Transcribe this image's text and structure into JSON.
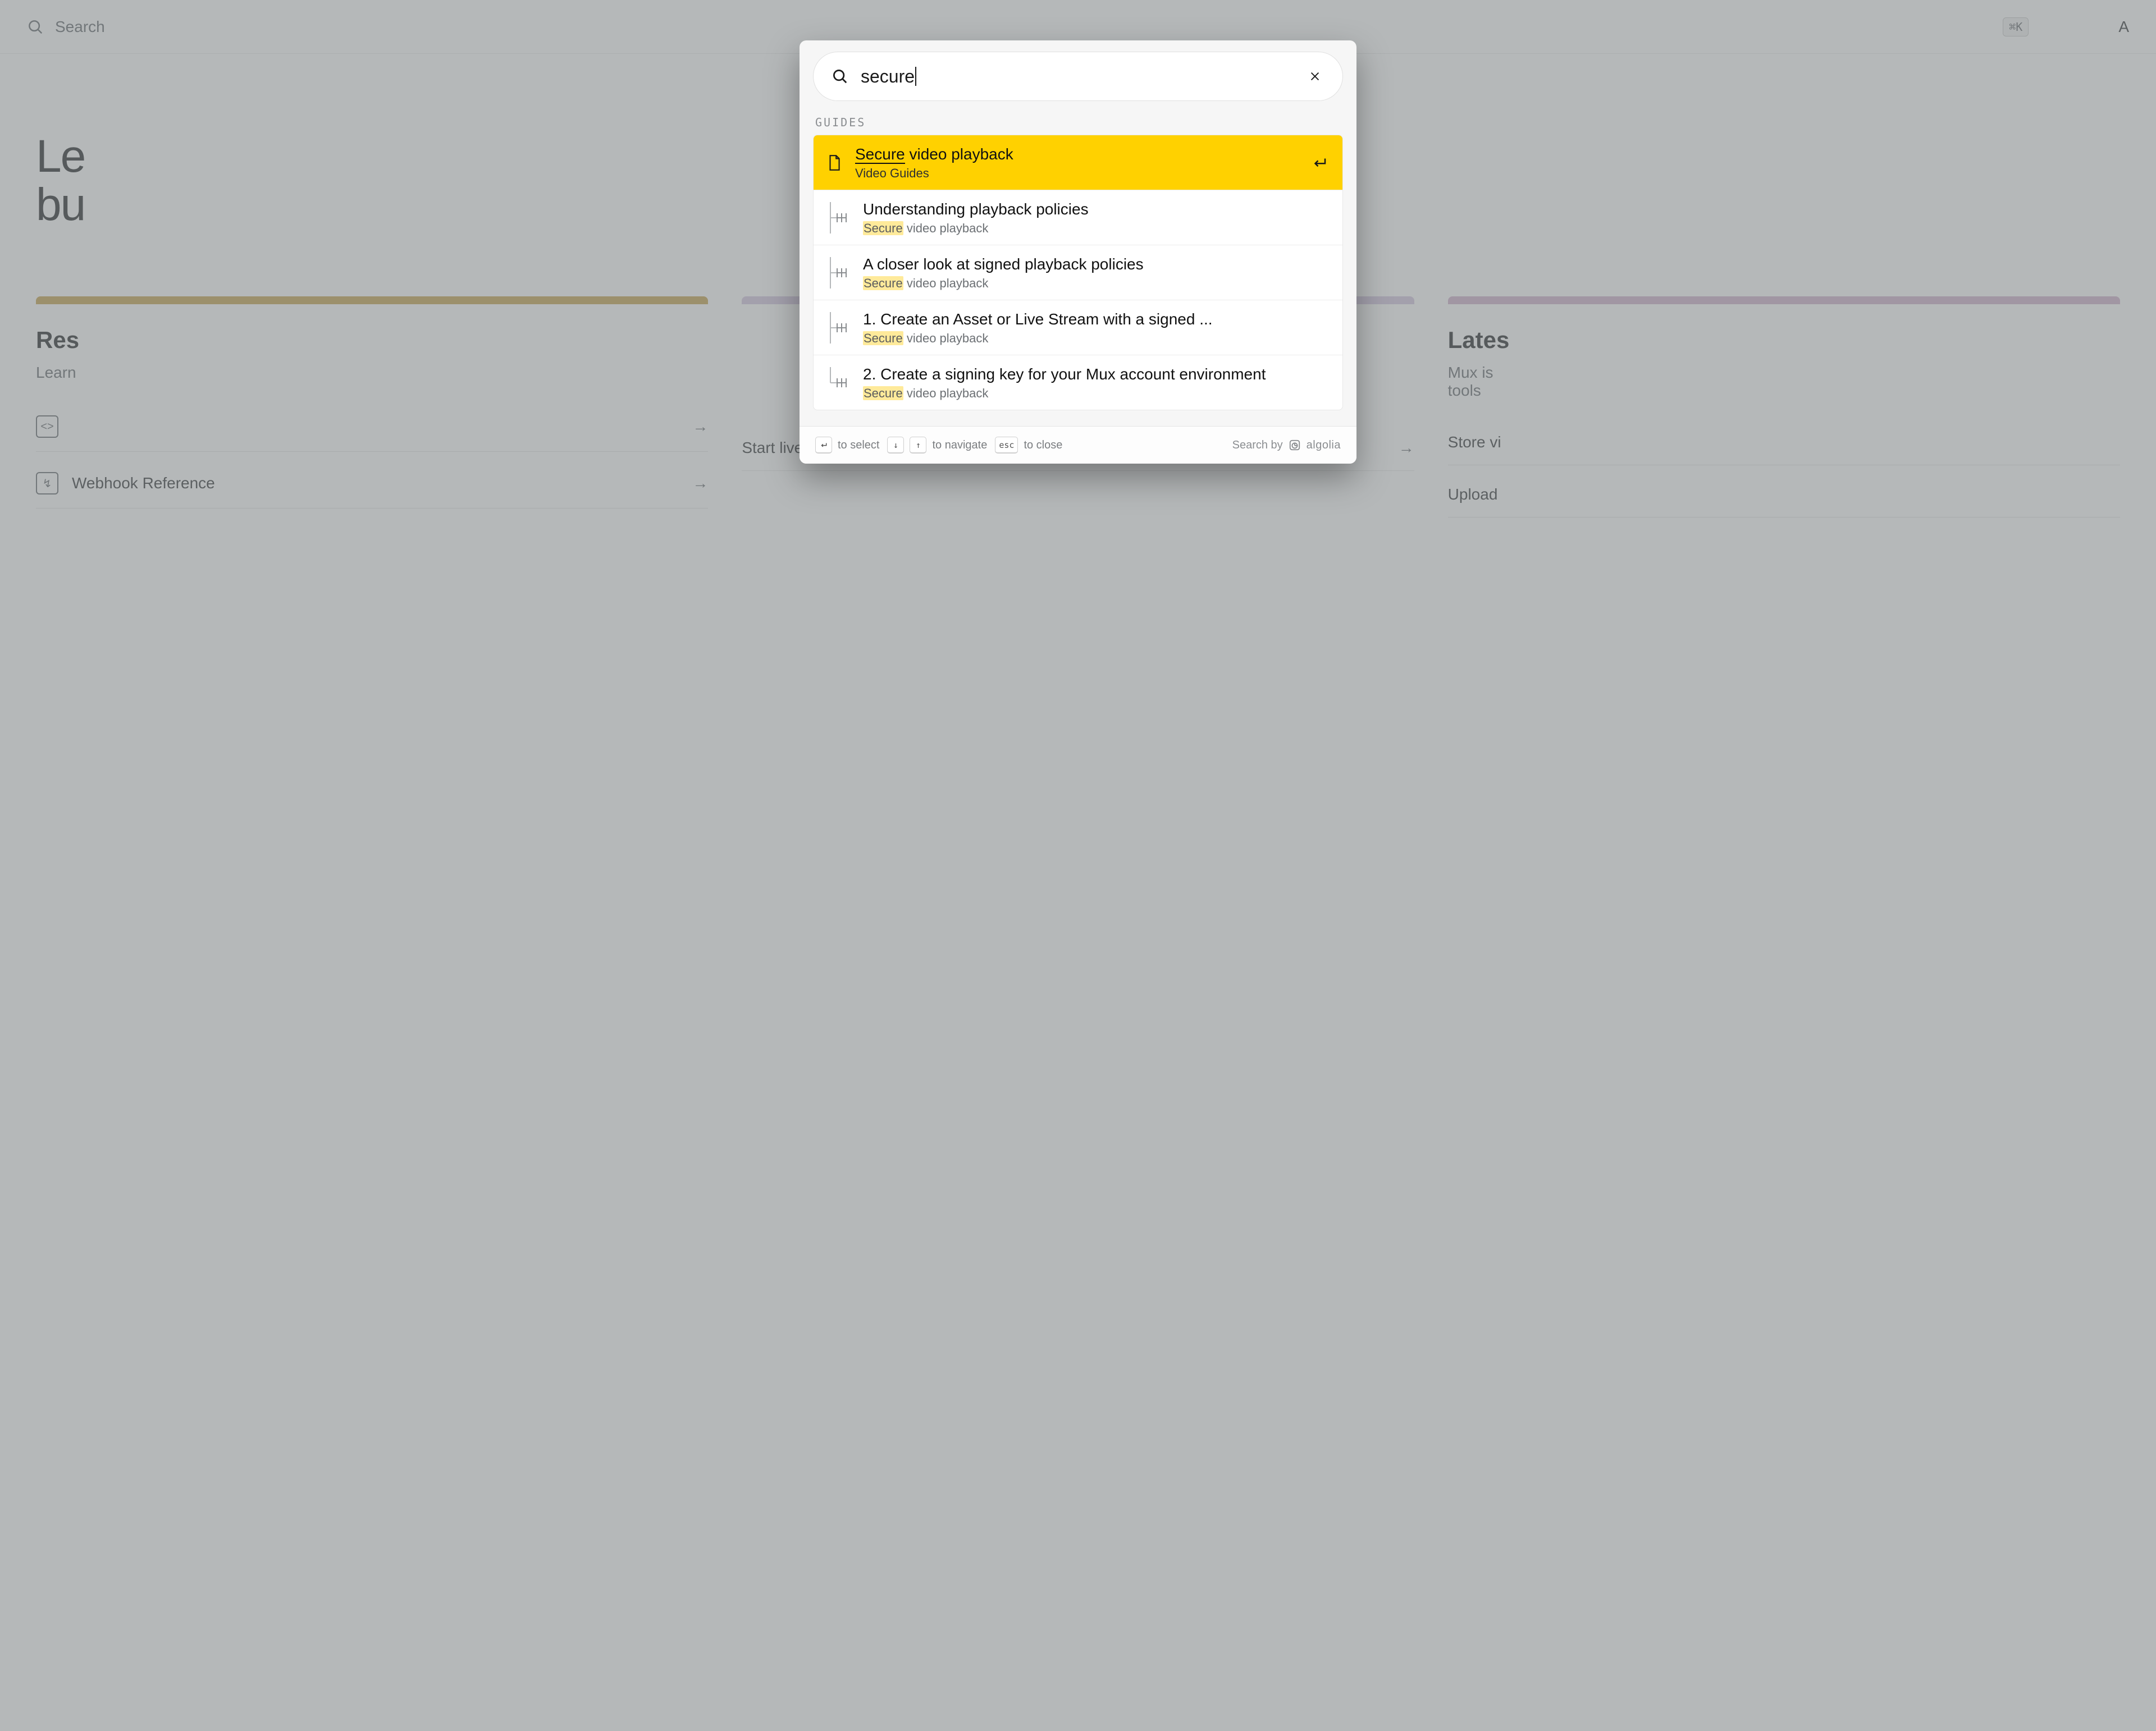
{
  "background": {
    "search_placeholder": "Search",
    "shortcut": "⌘K",
    "nav_right": "A",
    "hero_line1": "Le",
    "hero_line2": "bu",
    "cards": {
      "left": {
        "accent": "#c7a656",
        "title_fragment": "Res",
        "subtitle_fragment": "Learn",
        "links": [
          {
            "icon": "code",
            "label_fragment": ""
          },
          {
            "icon": "webhook",
            "label": "Webhook Reference"
          }
        ]
      },
      "middle": {
        "accent": "#d8c9e2",
        "links": [
          {
            "label": "Start live streaming"
          }
        ]
      },
      "right": {
        "accent": "#d3b4cf",
        "title_fragment": "Lates",
        "subtitle_line1_fragment": "Mux is ",
        "subtitle_line2_fragment": "tools",
        "links": [
          {
            "label_fragment": "Store vi"
          },
          {
            "label_fragment": "Upload"
          }
        ]
      }
    }
  },
  "modal": {
    "query": "secure",
    "section_label": "GUIDES",
    "results": [
      {
        "selected": true,
        "icon": "document",
        "title_highlight": "Secure",
        "title_rest": " video playback",
        "subtitle": "Video Guides",
        "subtitle_highlight": ""
      },
      {
        "selected": false,
        "icon": "tree-mid",
        "title": "Understanding playback policies",
        "subtitle_highlight": "Secure",
        "subtitle_rest": " video playback"
      },
      {
        "selected": false,
        "icon": "tree-mid",
        "title": "A closer look at signed playback policies",
        "subtitle_highlight": "Secure",
        "subtitle_rest": " video playback"
      },
      {
        "selected": false,
        "icon": "tree-mid",
        "title": "1. Create an Asset or Live Stream with a signed ...",
        "subtitle_highlight": "Secure",
        "subtitle_rest": " video playback"
      },
      {
        "selected": false,
        "icon": "tree-last",
        "title": "2. Create a signing key for your Mux account environment",
        "subtitle_highlight": "Secure",
        "subtitle_rest": " video playback"
      }
    ],
    "footer": {
      "select_label": "to select",
      "navigate_label": "to navigate",
      "close_label": "to close",
      "esc_key": "esc",
      "search_by": "Search by",
      "provider": "algolia"
    }
  }
}
